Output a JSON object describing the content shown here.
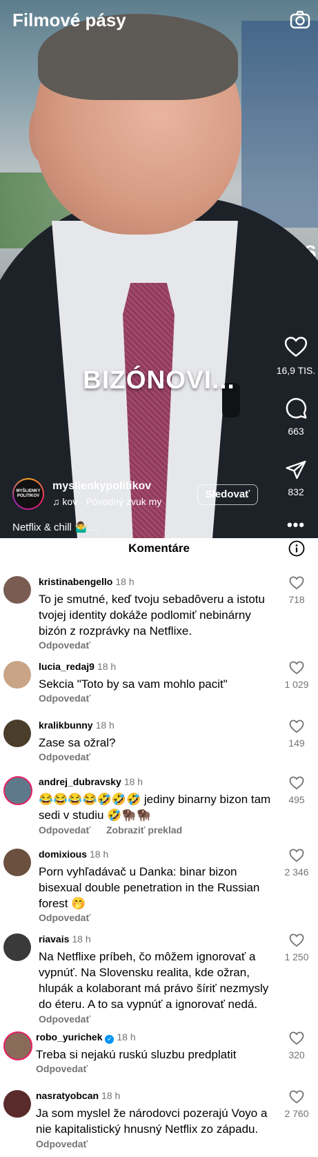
{
  "header": {
    "title": "Filmové pásy",
    "camera_icon": "camera-icon"
  },
  "video": {
    "caption": "BIZÓNOVI...",
    "overlay_text": "TIS",
    "likes": "16,9 TIS.",
    "comments": "663",
    "shares": "832",
    "author": "myslienkypolitikov",
    "avatar_text": "MYŠLIENKY POLITIKOV",
    "audio": "kov · Pôvodný zvuk    my",
    "follow_label": "Sledovať",
    "description": "Netflix & chill 🤷‍♂️ ..."
  },
  "comments_sheet": {
    "title": "Komentáre",
    "reply_label": "Odpovedať",
    "translate_label": "Zobraziť preklad",
    "items": [
      {
        "user": "kristinabengello",
        "time": "18 h",
        "text": "To je smutné, keď tvoju sebadôveru a istotu tvojej identity dokáže podlomiť nebinárny bizón z rozprávky na Netflixe.",
        "likes": "718",
        "avatar_color": "#7a5c52"
      },
      {
        "user": "lucia_redaj9",
        "time": "18 h",
        "text": "Sekcia \"Toto by sa vam mohlo pacit\"",
        "likes": "1 029",
        "avatar_color": "#c9a486"
      },
      {
        "user": "kralikbunny",
        "time": "18 h",
        "text": "Zase sa ožral?",
        "likes": "149",
        "avatar_color": "#4a3d2a"
      },
      {
        "user": "andrej_dubravsky",
        "time": "18 h",
        "text": "😂😂😂😂🤣🤣🤣 jediny binarny bizon tam sedi v studiu 🤣🦬🦬",
        "likes": "495",
        "avatar_color": "#5e7a8a"
      },
      {
        "user": "domixious",
        "time": "18 h",
        "text": "Porn vyhľadávač u Danka: binar bizon bisexual double penetration  in the Russian forest 🤭",
        "likes": "2 346",
        "avatar_color": "#6b4f3f"
      },
      {
        "user": "riavais",
        "time": "18 h",
        "text": "Na Netflixe príbeh, čo môžem ignorovať a vypnúť. Na Slovensku realita, kde ožran, hlupák a kolaborant má právo šíriť nezmysly do éteru. A to sa vypnúť a ignorovať nedá.",
        "likes": "1 250",
        "avatar_color": "#3a3a3a"
      },
      {
        "user": "robo_yurichek",
        "time": "18 h",
        "text": "Treba si nejakú ruskú sluzbu predplatit",
        "likes": "320",
        "avatar_color": "#8a6a58"
      },
      {
        "user": "nasratyobcan",
        "time": "18 h",
        "text": "Ja som myslel že národovci pozerajú Voyo a nie kapitalistický hnusný Netflix zo západu.",
        "likes": "2 760",
        "avatar_color": "#5a2b2b"
      }
    ]
  }
}
